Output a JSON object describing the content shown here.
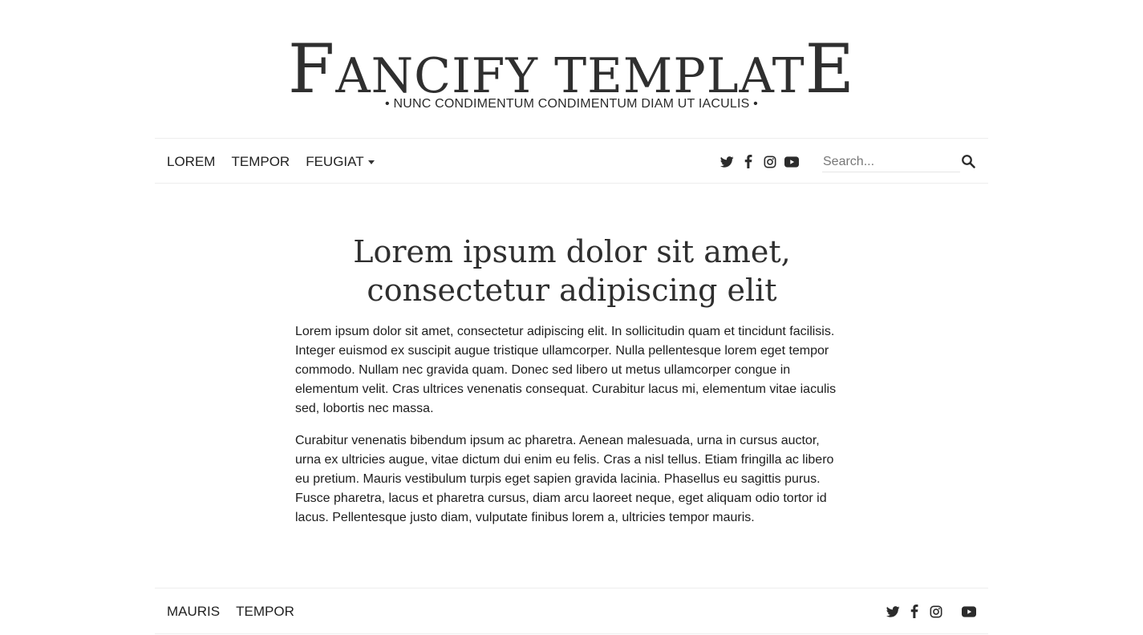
{
  "brand": {
    "first_letter": "F",
    "middle": "ANCIFY TEMPLAT",
    "last_letter": "E",
    "tagline": "• NUNC CONDIMENTUM CONDIMENTUM DIAM UT IACULIS •"
  },
  "nav": {
    "links": [
      "LOREM",
      "TEMPOR",
      "FEUGIAT"
    ],
    "dropdown_icon": "caret-down-icon"
  },
  "social_icons": [
    "twitter-icon",
    "facebook-icon",
    "instagram-icon",
    "youtube-icon"
  ],
  "search": {
    "placeholder": "Search...",
    "value": "",
    "icon": "search-icon"
  },
  "article": {
    "title_line1": "Lorem ipsum dolor sit amet,",
    "title_line2": "consectetur adipiscing elit",
    "paragraphs": [
      "Lorem ipsum dolor sit amet, consectetur adipiscing elit. In sollicitudin quam et tincidunt facilisis. Integer euismod ex suscipit augue tristique ullamcorper. Nulla pellentesque lorem eget tempor commodo. Nullam nec gravida quam. Donec sed libero ut metus ullamcorper congue in elementum velit. Cras ultrices venenatis consequat. Curabitur lacus mi, elementum vitae iaculis sed, lobortis nec massa.",
      "Curabitur venenatis bibendum ipsum ac pharetra. Aenean malesuada, urna in cursus auctor, urna ex ultricies augue, vitae dictum dui enim eu felis. Cras a nisl tellus. Etiam fringilla ac libero eu pretium. Mauris vestibulum turpis eget sapien gravida lacinia. Phasellus eu sagittis purus. Fusce pharetra, lacus et pharetra cursus, diam arcu laoreet neque, eget aliquam odio tortor id lacus. Pellentesque justo diam, vulputate finibus lorem a, ultricies tempor mauris."
    ]
  },
  "footer": {
    "links": [
      "MAURIS",
      "TEMPOR"
    ]
  },
  "colors": {
    "text": "#212529",
    "heading": "#2f2f2f",
    "border": "#eeeeee",
    "background": "#ffffff"
  }
}
